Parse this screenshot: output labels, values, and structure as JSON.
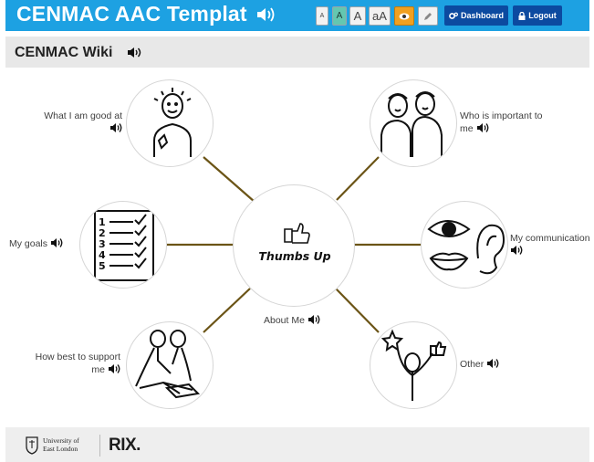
{
  "header": {
    "title": "CENMAC AAC Templat",
    "text_size_buttons": [
      "A",
      "A",
      "A",
      "aA"
    ],
    "dashboard_label": "Dashboard",
    "logout_label": "Logout",
    "accent_color": "#1da1e2",
    "nav_button_color": "#0c4aa0"
  },
  "wiki": {
    "title": "CENMAC Wiki"
  },
  "mindmap": {
    "center": {
      "label": "Thumbs Up",
      "caption": "About Me"
    },
    "nodes": [
      {
        "label": "What I am good at",
        "icon": "person-good-at-icon"
      },
      {
        "label": "Who is important to me",
        "label_line1": "Who is important to",
        "label_line2": "me",
        "icon": "two-people-icon"
      },
      {
        "label": "My goals",
        "icon": "numbered-checklist-icon"
      },
      {
        "label": "My communication",
        "icon": "eye-ear-mouth-icon"
      },
      {
        "label": "How best to support me",
        "label_line1": "How best to support",
        "label_line2": "me",
        "icon": "support-people-icon"
      },
      {
        "label": "Other",
        "icon": "star-thumbs-person-icon"
      }
    ],
    "line_color": "#6b5416"
  },
  "footer": {
    "uel_line1": "University of",
    "uel_line2": "East London",
    "rix": "RIX."
  }
}
